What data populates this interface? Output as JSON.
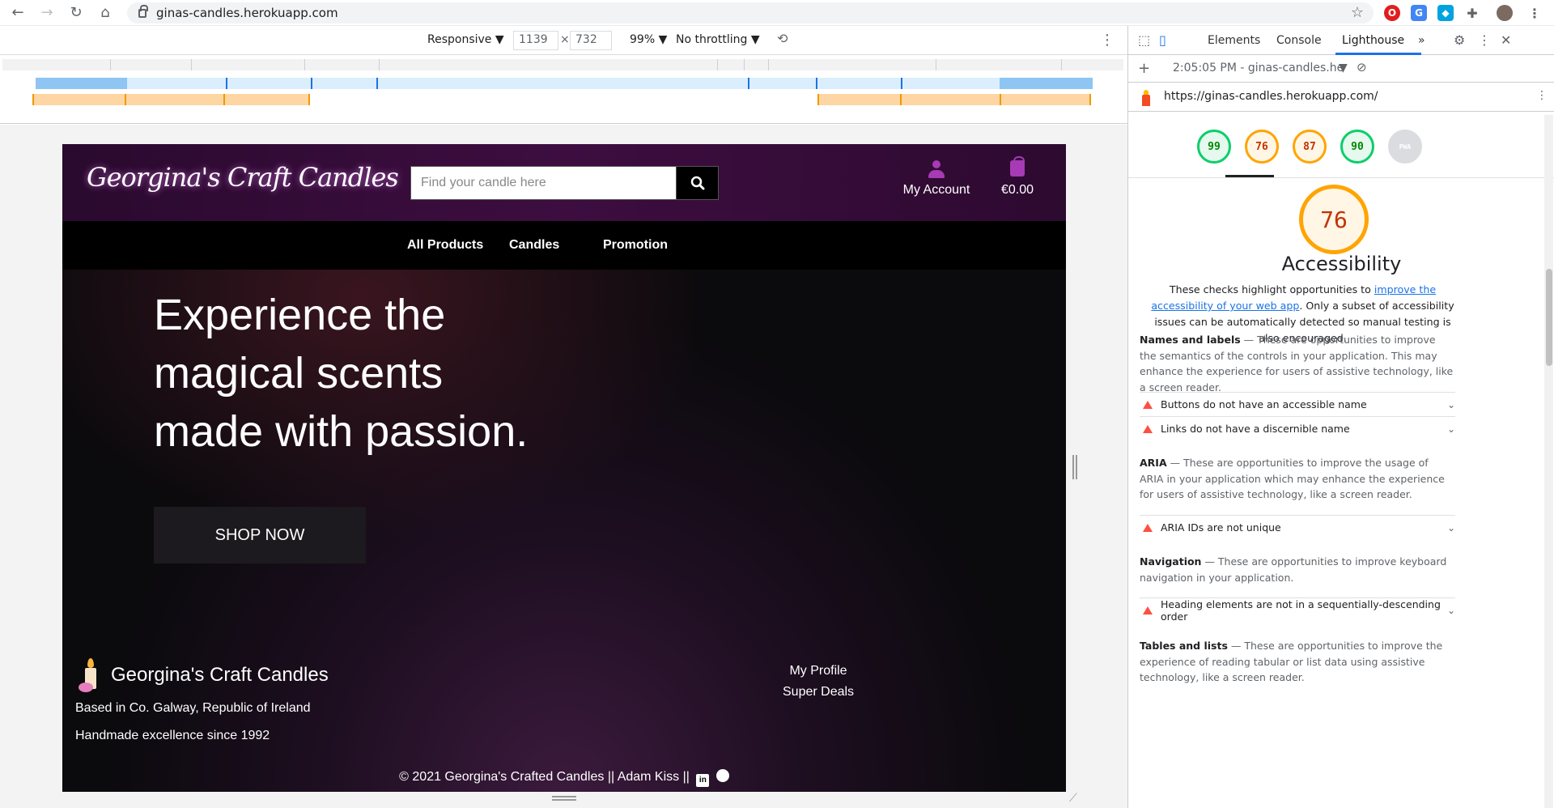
{
  "browser": {
    "url": "ginas-candles.herokuapp.com",
    "nav": [
      "back-icon",
      "forward-icon",
      "reload-icon",
      "home-icon"
    ]
  },
  "device_toolbar": {
    "device": "Responsive ▼",
    "width": "1139",
    "height": "732",
    "x": "×",
    "zoom": "99% ▼",
    "throttling": "No throttling ▼"
  },
  "site": {
    "logo": "Georgina's Craft Candles",
    "search_placeholder": "Find your candle here",
    "account_label": "My Account",
    "cart_total": "€0.00",
    "nav": [
      "All Products",
      "Candles",
      "Promotion"
    ],
    "hero_lines": [
      "Experience the",
      "magical scents",
      "made with passion."
    ],
    "shop_now": "SHOP NOW",
    "footer_brand": "Georgina's Craft Candles",
    "footer_location": "Based in Co. Galway, Republic of Ireland",
    "footer_since": "Handmade excellence since 1992",
    "footer_links": [
      "My Profile",
      "Super Deals"
    ],
    "copyright": "© 2021 Georgina's Crafted Candles || Adam Kiss ||"
  },
  "devtools": {
    "tabs": [
      "Elements",
      "Console",
      "Lighthouse",
      "»"
    ],
    "report_time": "2:05:05 PM - ginas-candles.he",
    "report_url": "https://ginas-candles.herokuapp.com/",
    "scores": [
      "99",
      "76",
      "87",
      "90",
      "PWA"
    ],
    "big_score": "76",
    "category_title": "Accessibility",
    "desc_1": "These checks highlight opportunities to ",
    "desc_link": "improve the accessibility of your web app",
    "desc_2": ". Only a subset of accessibility issues can be automatically detected so manual testing is also encouraged.",
    "names_head": "Names and labels",
    "names_text": " — These are opportunities to improve the semantics of the controls in your application. This may enhance the experience for users of assistive technology, like a screen reader.",
    "audit_1": "Buttons do not have an accessible name",
    "audit_2": "Links do not have a discernible name",
    "aria_head": "ARIA",
    "aria_text": " — These are opportunities to improve the usage of ARIA in your application which may enhance the experience for users of assistive technology, like a screen reader.",
    "audit_3": "ARIA IDs are not unique",
    "navigation_head": "Navigation",
    "navigation_text": " — These are opportunities to improve keyboard navigation in your application.",
    "audit_4": "Heading elements are not in a sequentially-descending order",
    "tables_head": "Tables and lists",
    "tables_text": " — These are opportunities to improve the experience of reading tabular or list data using assistive technology, like a screen reader."
  },
  "colors": {
    "pass": "#0cce6b",
    "average": "#ffa400",
    "fail": "#ff4e42",
    "accent": "#1a73e8",
    "brand_purple": "#a73ab5"
  }
}
